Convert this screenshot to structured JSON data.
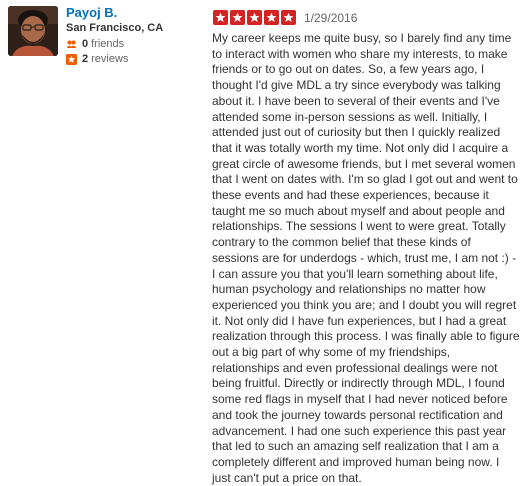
{
  "reviewer": {
    "name": "Payoj B.",
    "location": "San Francisco, CA",
    "friends_count": "0",
    "friends_label": "friends",
    "reviews_count": "2",
    "reviews_label": "reviews",
    "avatar_icon": "avatar-photo",
    "friends_icon": "friends-icon",
    "reviews_icon": "star-badge-icon"
  },
  "review": {
    "rating": 5,
    "max_rating": 5,
    "date": "1/29/2016",
    "text": "My career keeps me quite busy, so I barely find any time to interact with women who share my interests, to make friends or to go out on dates. So, a few years ago, I thought I'd give MDL a try since everybody was talking about it. I have been to several of their events and I've attended some in-person sessions as well. Initially, I  attended just out of curiosity but then I quickly realized that it was totally worth my time. Not only did I acquire a great circle of awesome friends, but I met several women that I went on dates with. I'm so glad I got out and went to these events and had these experiences, because it taught me so much about myself and about people and relationships. The sessions I went to were great. Totally contrary to the common belief that these kinds of sessions are for underdogs - which, trust me, I am not :) - I can assure you that you'll learn something about life, human psychology and relationships no matter how experienced you think you are; and I doubt you will regret it. Not only did I have fun experiences, but I had a great realization through this process. I was finally able to figure out a big part of why some of my friendships, relationships and even professional dealings were not being fruitful. Directly or indirectly through MDL, I found some red flags in myself that I had never noticed before and took the journey towards personal rectification and advancement. I had one such experience this past year that led to such an amazing self realization that I am a completely different and improved human being now. I just can't put a price on that."
  },
  "colors": {
    "star_red": "#d32323",
    "link_blue": "#0073bb",
    "text": "#333333",
    "muted": "#666666",
    "friends_orange": "#f15c00"
  }
}
